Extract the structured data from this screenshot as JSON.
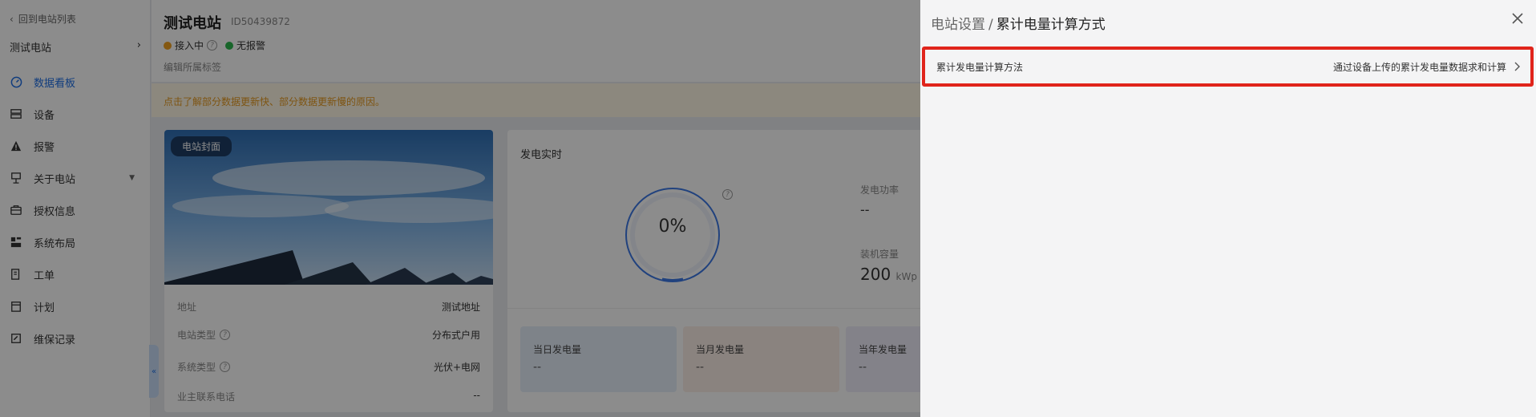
{
  "sidebar": {
    "back_label": "回到电站列表",
    "station_name": "测试电站",
    "items": [
      {
        "label": "数据看板",
        "icon": "dashboard-icon",
        "active": true
      },
      {
        "label": "设备",
        "icon": "device-icon"
      },
      {
        "label": "报警",
        "icon": "alarm-icon"
      },
      {
        "label": "关于电站",
        "icon": "station-icon",
        "expandable": true
      },
      {
        "label": "授权信息",
        "icon": "auth-icon"
      },
      {
        "label": "系统布局",
        "icon": "layout-icon"
      },
      {
        "label": "工单",
        "icon": "workorder-icon"
      },
      {
        "label": "计划",
        "icon": "plan-icon"
      },
      {
        "label": "维保记录",
        "icon": "maintenance-icon"
      }
    ],
    "collapse_glyph": "«"
  },
  "header": {
    "title": "测试电站",
    "id_text": "ID50439872",
    "status_connecting": "接入中",
    "status_no_alarm": "无报警",
    "tag_edit": "编辑所属标签"
  },
  "notice": "点击了解部分数据更新快、部分数据更新慢的原因。",
  "cover": {
    "badge": "电站封面",
    "rows": [
      {
        "key": "地址",
        "value": "测试地址",
        "help": false
      },
      {
        "key": "电站类型",
        "value": "分布式户用",
        "help": true
      },
      {
        "key": "系统类型",
        "value": "光伏+电网",
        "help": true
      },
      {
        "key": "业主联系电话",
        "value": "--",
        "help": false
      }
    ]
  },
  "realtime": {
    "title": "发电实时",
    "gauge_value": "0%",
    "gauge_fraction": 0.0,
    "power_label": "发电功率",
    "power_value": "--",
    "capacity_label": "装机容量",
    "capacity_value": "200",
    "capacity_unit": "kWp",
    "stats": [
      {
        "label": "当日发电量",
        "value": "--",
        "bg": "#e6effa"
      },
      {
        "label": "当月发电量",
        "value": "--",
        "bg": "#fbefe7"
      },
      {
        "label": "当年发电量",
        "value": "--",
        "bg": "#eeedf9"
      }
    ]
  },
  "drawer": {
    "breadcrumb_parent": "电站设置",
    "breadcrumb_sep": "/",
    "title": "累计电量计算方式",
    "row_label": "累计发电量计算方法",
    "row_value": "通过设备上传的累计发电量数据求和计算",
    "highlight_color": "#e0241b"
  }
}
